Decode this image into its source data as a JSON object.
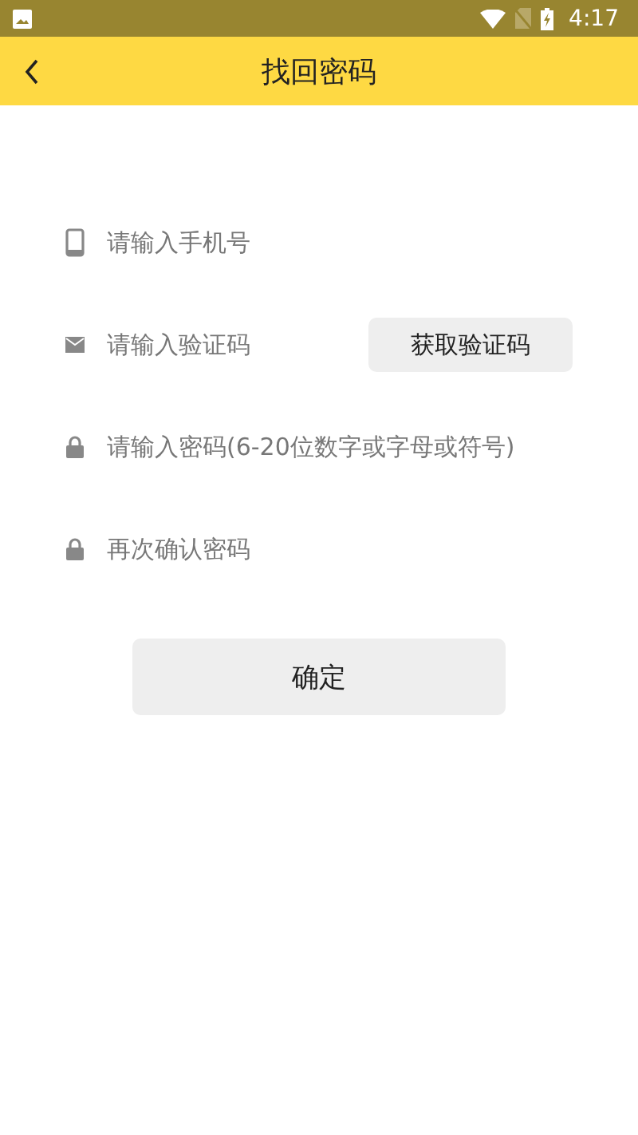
{
  "status_bar": {
    "time": "4:17"
  },
  "header": {
    "title": "找回密码"
  },
  "fields": [
    {
      "kind": "phone",
      "placeholder": "请输入手机号"
    },
    {
      "kind": "code",
      "placeholder": "请输入验证码",
      "button": "获取验证码"
    },
    {
      "kind": "password",
      "placeholder": "请输入密码(6-20位数字或字母或符号)"
    },
    {
      "kind": "password",
      "placeholder": "再次确认密码"
    }
  ],
  "submit": "确定"
}
